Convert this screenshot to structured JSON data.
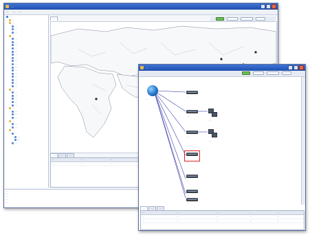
{
  "colors": {
    "titlebar": "#2a5cc6",
    "link_line": "#3a3aa8",
    "map_marker": "#222222",
    "log_text": "#2b47b5"
  },
  "main_window": {
    "title": "…",
    "menu": [
      "…",
      "…",
      "…"
    ],
    "map_tab": "…",
    "tree": [
      {
        "label": "…",
        "depth": 0,
        "icon": "network-icon"
      },
      {
        "label": "…",
        "depth": 1,
        "icon": "folder-icon"
      },
      {
        "label": "…",
        "depth": 1,
        "icon": "folder-icon"
      },
      {
        "label": "…",
        "depth": 2,
        "icon": "device-icon"
      },
      {
        "label": "…",
        "depth": 2,
        "icon": "device-icon"
      },
      {
        "label": "…",
        "depth": 2,
        "icon": "device-icon"
      },
      {
        "label": "…",
        "depth": 1,
        "icon": "folder-icon"
      },
      {
        "label": "…",
        "depth": 2,
        "icon": "device-icon"
      },
      {
        "label": "…",
        "depth": 2,
        "icon": "device-icon"
      },
      {
        "label": "…",
        "depth": 2,
        "icon": "device-icon"
      },
      {
        "label": "…",
        "depth": 2,
        "icon": "device-icon"
      },
      {
        "label": "…",
        "depth": 2,
        "icon": "device-icon"
      },
      {
        "label": "…",
        "depth": 2,
        "icon": "device-icon"
      },
      {
        "label": "…",
        "depth": 2,
        "icon": "device-icon"
      },
      {
        "label": "…",
        "depth": 2,
        "icon": "device-icon"
      },
      {
        "label": "…",
        "depth": 2,
        "icon": "device-icon"
      },
      {
        "label": "…",
        "depth": 2,
        "icon": "device-icon"
      },
      {
        "label": "…",
        "depth": 2,
        "icon": "device-icon"
      },
      {
        "label": "…",
        "depth": 2,
        "icon": "device-icon"
      },
      {
        "label": "…",
        "depth": 2,
        "icon": "device-icon"
      },
      {
        "label": "…",
        "depth": 2,
        "icon": "device-icon"
      },
      {
        "label": "…",
        "depth": 2,
        "icon": "device-icon"
      },
      {
        "label": "…",
        "depth": 2,
        "icon": "device-icon"
      },
      {
        "label": "…",
        "depth": 1,
        "icon": "folder-icon"
      },
      {
        "label": "…",
        "depth": 2,
        "icon": "device-icon"
      },
      {
        "label": "…",
        "depth": 2,
        "icon": "device-icon"
      },
      {
        "label": "…",
        "depth": 2,
        "icon": "device-icon"
      },
      {
        "label": "…",
        "depth": 2,
        "icon": "device-icon"
      },
      {
        "label": "…",
        "depth": 2,
        "icon": "device-icon"
      },
      {
        "label": "…",
        "depth": 1,
        "icon": "folder-icon"
      },
      {
        "label": "…",
        "depth": 2,
        "icon": "device-icon"
      },
      {
        "label": "…",
        "depth": 2,
        "icon": "device-icon"
      },
      {
        "label": "…",
        "depth": 2,
        "icon": "device-icon"
      },
      {
        "label": "…",
        "depth": 1,
        "icon": "folder-icon"
      },
      {
        "label": "…",
        "depth": 2,
        "icon": "device-icon"
      },
      {
        "label": "…",
        "depth": 2,
        "icon": "device-icon"
      },
      {
        "label": "…",
        "depth": 1,
        "icon": "folder-icon"
      },
      {
        "label": "…",
        "depth": 2,
        "icon": "device-icon"
      },
      {
        "label": "…",
        "depth": 3,
        "icon": "device-icon"
      },
      {
        "label": "…",
        "depth": 3,
        "icon": "device-icon"
      },
      {
        "label": "…",
        "depth": 2,
        "icon": "device-icon"
      }
    ],
    "bottom_tabs": [
      "…",
      "…",
      "…"
    ],
    "bottom_grid_headers": [
      "…",
      "…",
      "…"
    ],
    "bottom_grid_rows": [
      [
        "…",
        "…",
        "…"
      ]
    ],
    "log_lines": [
      "…",
      "…",
      "…",
      "…",
      "…"
    ]
  },
  "topology_window": {
    "title": "…",
    "root_label": "…",
    "devices": [
      {
        "label": "…",
        "kind": "switch"
      },
      {
        "label": "…",
        "kind": "switch"
      },
      {
        "label": "…",
        "kind": "switch"
      },
      {
        "label": "…",
        "kind": "switch"
      },
      {
        "label": "…",
        "kind": "switch"
      },
      {
        "label": "…",
        "kind": "switch"
      },
      {
        "label": "…",
        "kind": "switch"
      },
      {
        "label": "…",
        "kind": "pc-group"
      },
      {
        "label": "…",
        "kind": "pc-group"
      }
    ],
    "bottom_tabs": [
      "…",
      "…",
      "…"
    ],
    "grid_headers": [
      "…",
      "…",
      "…",
      "…",
      "…"
    ],
    "grid_rows": [
      [
        "…",
        "…",
        "…",
        "…",
        "…"
      ],
      [
        "…",
        "…",
        "…",
        "…",
        "…"
      ]
    ]
  }
}
